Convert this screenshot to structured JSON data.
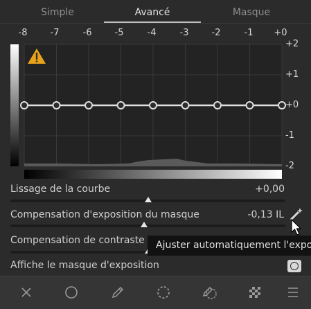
{
  "tabs": [
    {
      "label": "Simple"
    },
    {
      "label": "Avancé",
      "active": true
    },
    {
      "label": "Masque"
    }
  ],
  "ev_axis": {
    "top_labels": [
      "-8",
      "-7",
      "-6",
      "-5",
      "-4",
      "-3",
      "-2",
      "-1",
      "+0"
    ],
    "right_labels": [
      "+2",
      "+1",
      "+0",
      "-1",
      "-2"
    ]
  },
  "curve": {
    "node_count": 9,
    "level": 0
  },
  "rows": {
    "lissage": {
      "label": "Lissage de la courbe",
      "value": "+0,00",
      "position": 0.5
    },
    "comp_expo": {
      "label": "Compensation d'exposition du masque",
      "value": "-0,13 IL",
      "position": 0.485
    },
    "comp_contraste": {
      "label": "Compensation de contraste d",
      "position": 0.5
    },
    "affiche": {
      "label": "Affiche le masque d'exposition"
    }
  },
  "tooltip": {
    "text": "Ajuster automatiquement l'expo"
  },
  "icons": {
    "warning": "warning-icon",
    "auto": "magic-wand-icon",
    "toolbar": [
      "close-icon",
      "circle-icon",
      "pencil-icon",
      "dashed-circle-icon",
      "pen-target-icon",
      "checker-icon",
      "menu-icon"
    ]
  },
  "colors": {
    "background": "#2b2b2b",
    "warning": "#e8a31b",
    "curve": "#e0e0e0"
  }
}
